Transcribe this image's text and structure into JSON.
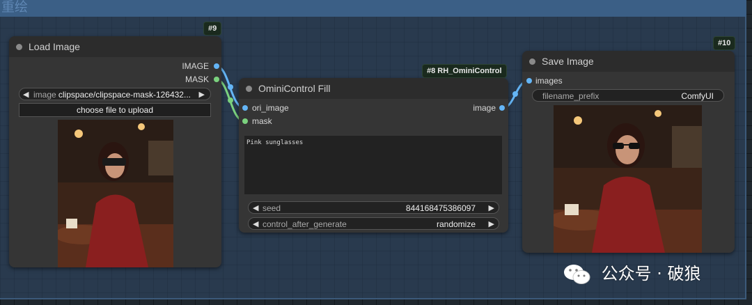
{
  "group": {
    "title": "重绘"
  },
  "load_image_node": {
    "id_badge": "#9",
    "title": "Load Image",
    "outputs": [
      "IMAGE",
      "MASK"
    ],
    "image_widget": {
      "label": "image",
      "value": "clipspace/clipspace-mask-126432..."
    },
    "upload_button": "choose file to upload"
  },
  "omini_node": {
    "id_badge": "#8 RH_OminiControl",
    "title": "OminiControl Fill",
    "inputs": [
      "ori_image",
      "mask"
    ],
    "outputs": [
      "image"
    ],
    "prompt": "Pink sunglasses",
    "seed_widget": {
      "label": "seed",
      "value": "844168475386097"
    },
    "control_widget": {
      "label": "control_after_generate",
      "value": "randomize"
    }
  },
  "save_image_node": {
    "id_badge": "#10",
    "title": "Save Image",
    "inputs": [
      "images"
    ],
    "filename_widget": {
      "label": "filename_prefix",
      "value": "ComfyUI"
    }
  },
  "watermark": {
    "icon": "wechat-icon",
    "text": "公众号 · 破狼"
  },
  "colors": {
    "image_port": "#64b5f6",
    "mask_port": "#7bd17e",
    "node_bg": "#353535",
    "group_header": "#3b5f86"
  }
}
